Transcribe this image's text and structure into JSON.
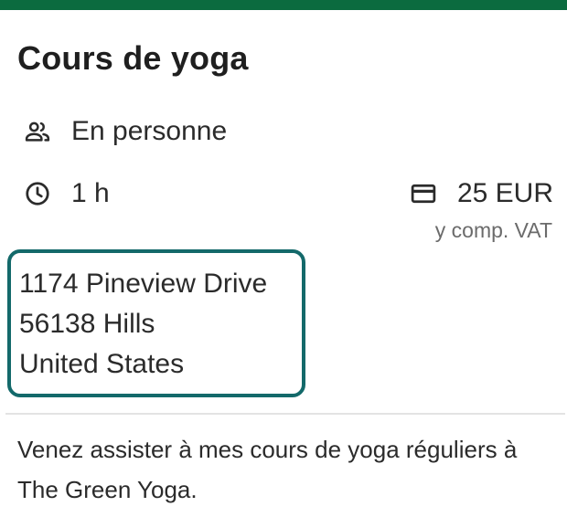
{
  "theme": {
    "accent": "#0b6b3f",
    "focus_outline": "#13696a"
  },
  "header": {
    "title": "Cours de yoga"
  },
  "details": {
    "mode": {
      "icon": "people-icon",
      "label": "En personne"
    },
    "duration": {
      "icon": "clock-icon",
      "label": "1 h"
    },
    "price": {
      "icon": "credit-card-icon",
      "label": "25 EUR",
      "tax_note": "y comp. VAT"
    }
  },
  "address": {
    "line1": "1174 Pineview Drive",
    "line2": "56138 Hills",
    "line3": "United States"
  },
  "description": "Venez assister à mes cours de yoga réguliers à The Green Yoga."
}
